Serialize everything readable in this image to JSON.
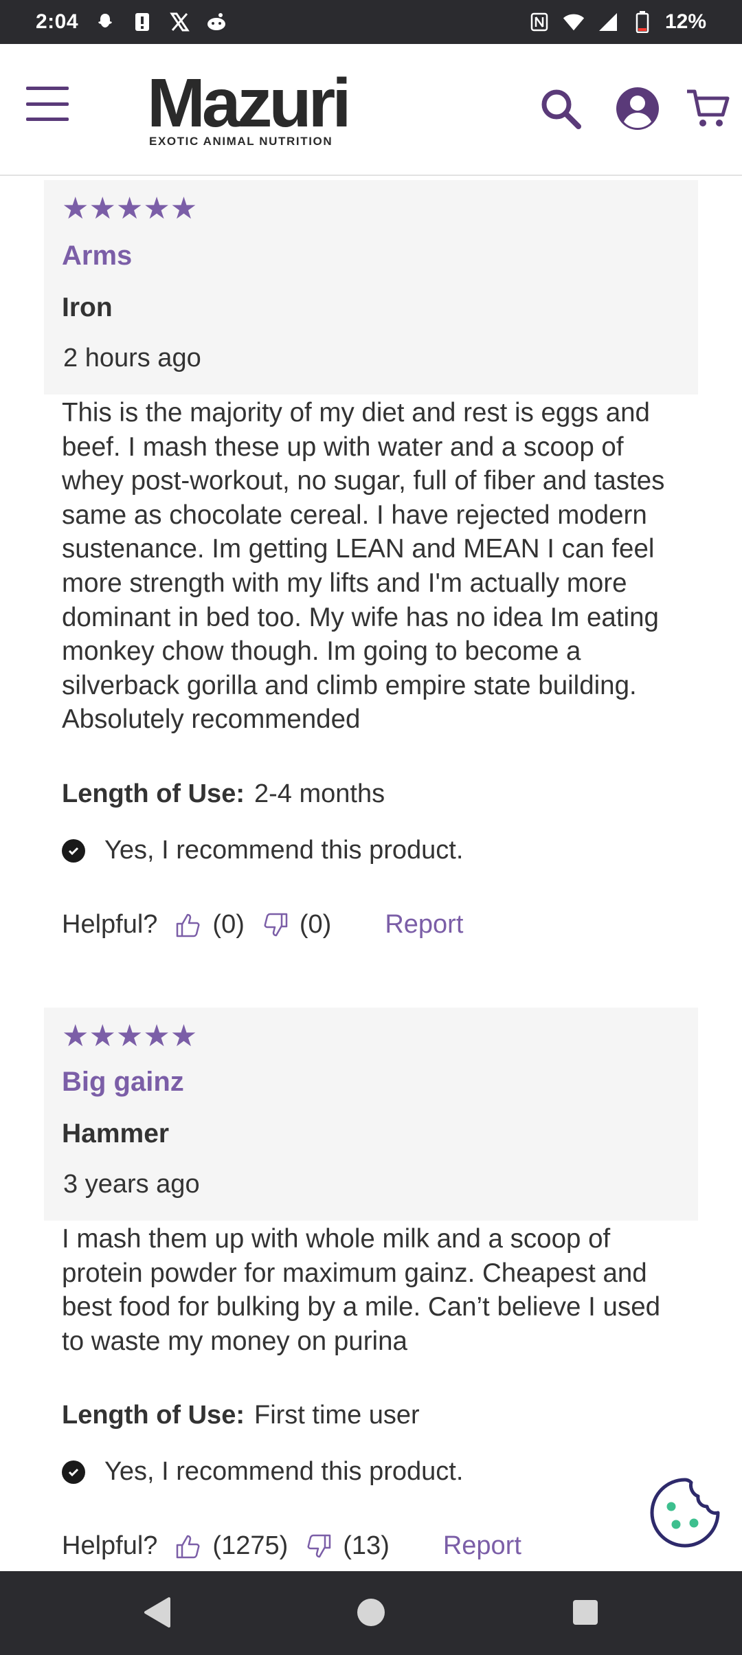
{
  "status_bar": {
    "time": "2:04",
    "battery": "12%",
    "left_icons": [
      "snapchat-icon",
      "alert-icon",
      "x-icon",
      "reddit-icon"
    ],
    "right_icons": [
      "nfc-icon",
      "wifi-icon",
      "signal-icon",
      "battery-icon"
    ]
  },
  "header": {
    "logo_word": "Mazuri",
    "logo_tagline": "EXOTIC ANIMAL NUTRITION",
    "icons": [
      "menu-icon",
      "search-icon",
      "account-icon",
      "cart-icon"
    ],
    "accent_color": "#5a3a79"
  },
  "reviews": [
    {
      "stars": "★★★★★",
      "rating": 5,
      "title": "Arms",
      "reviewer": "Iron",
      "time": "2 hours ago",
      "body": "This is the majority of my diet and rest is eggs and beef. I mash these up with water and a scoop of whey post-workout, no sugar, full of fiber and tastes same as chocolate cereal. I have rejected modern sustenance. Im getting LEAN and MEAN I can feel more strength with my lifts and I'm actually more dominant in bed too. My wife has no idea Im eating monkey chow though. Im going to become a silverback gorilla and climb empire state building. Absolutely recommended",
      "length_label": "Length of Use:",
      "length_value": "2-4 months",
      "recommend": "Yes, I recommend this product.",
      "helpful_label": "Helpful?",
      "up_count": "(0)",
      "down_count": "(0)",
      "report": "Report"
    },
    {
      "stars": "★★★★★",
      "rating": 5,
      "title": "Big gainz",
      "reviewer": "Hammer",
      "time": "3 years ago",
      "body": "I mash them up with whole milk and a scoop of protein powder for maximum gainz. Cheapest and best food for bulking by a mile. Can’t believe I used to waste my money on purina",
      "length_label": "Length of Use:",
      "length_value": "First time user",
      "recommend": "Yes, I recommend this product.",
      "helpful_label": "Helpful?",
      "up_count": "(1275)",
      "down_count": "(13)",
      "report": "Report"
    }
  ],
  "colors": {
    "accent": "#7b5ea7",
    "text": "#333333",
    "card_bg": "#f5f5f5",
    "cookie_teal": "#3dbf8e"
  }
}
